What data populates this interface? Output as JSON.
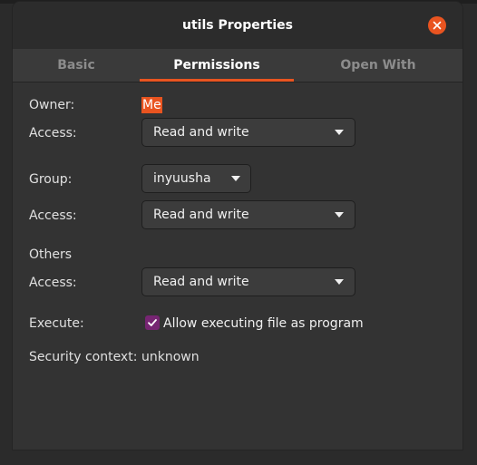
{
  "window": {
    "title": "utils Properties"
  },
  "tabs": [
    {
      "label": "Basic"
    },
    {
      "label": "Permissions"
    },
    {
      "label": "Open With"
    }
  ],
  "active_tab": "Permissions",
  "owner": {
    "label": "Owner:",
    "value": "Me"
  },
  "owner_access": {
    "label": "Access:",
    "value": "Read and write"
  },
  "group": {
    "label": "Group:",
    "value": "inyuusha"
  },
  "group_access": {
    "label": "Access:",
    "value": "Read and write"
  },
  "others": {
    "heading": "Others"
  },
  "others_access": {
    "label": "Access:",
    "value": "Read and write"
  },
  "execute": {
    "label": "Execute:",
    "checkbox_label": "Allow executing file as program",
    "checked": true
  },
  "security": {
    "label": "Security context:",
    "value": "unknown"
  },
  "colors": {
    "accent": "#e95420",
    "checkbox": "#762572",
    "background": "#333333"
  },
  "icons": {
    "close": "close-icon",
    "dropdown": "chevron-down-icon",
    "check": "check-icon"
  }
}
